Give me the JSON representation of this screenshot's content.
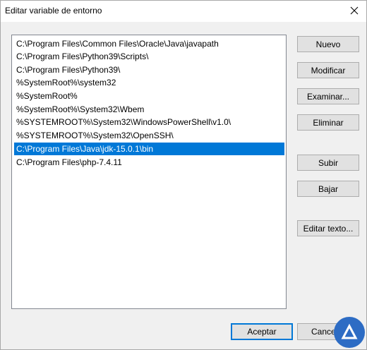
{
  "window": {
    "title": "Editar variable de entorno",
    "close_icon": "close-icon"
  },
  "list": {
    "items": [
      "C:\\Program Files\\Common Files\\Oracle\\Java\\javapath",
      "C:\\Program Files\\Python39\\Scripts\\",
      "C:\\Program Files\\Python39\\",
      "%SystemRoot%\\system32",
      "%SystemRoot%",
      "%SystemRoot%\\System32\\Wbem",
      "%SYSTEMROOT%\\System32\\WindowsPowerShell\\v1.0\\",
      "%SYSTEMROOT%\\System32\\OpenSSH\\",
      "C:\\Program Files\\Java\\jdk-15.0.1\\bin",
      "C:\\Program Files\\php-7.4.11"
    ],
    "selected_index": 8
  },
  "buttons": {
    "nuevo": "Nuevo",
    "modificar": "Modificar",
    "examinar": "Examinar...",
    "eliminar": "Eliminar",
    "subir": "Subir",
    "bajar": "Bajar",
    "editar_texto": "Editar texto...",
    "aceptar": "Aceptar",
    "cancelar": "Cancelar"
  },
  "colors": {
    "selection": "#0078d7",
    "watermark": "#2d6cc4"
  }
}
